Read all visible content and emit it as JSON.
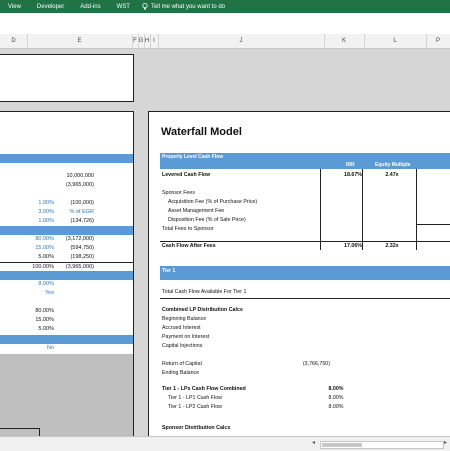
{
  "ribbon": {
    "tabs": [
      "View",
      "Developer",
      "Add-ins",
      "WST"
    ],
    "tell_me": "Tell me what you want to do"
  },
  "column_headers": [
    "D",
    "E",
    "F",
    "G",
    "H",
    "I",
    "J",
    "K",
    "L",
    "P"
  ],
  "left_panel": {
    "block1": [
      {
        "d": "",
        "e": "10,000,000"
      },
      {
        "d": "",
        "e": "(3,965,000)"
      },
      {
        "d": "1.00%",
        "e": "(100,000)"
      },
      {
        "d": "3.00%",
        "e": "% of EGR"
      },
      {
        "d": "1.00%",
        "e": "(134,726)"
      }
    ],
    "block2": [
      {
        "d": "80.00%",
        "e": "(3,172,000)"
      },
      {
        "d": "15.00%",
        "e": "(594,750)"
      },
      {
        "d": "5.00%",
        "e": "(198,250)"
      },
      {
        "d": "100.00%",
        "e": "(3,965,000)"
      }
    ],
    "block3": [
      {
        "d": "8.00%",
        "e": ""
      },
      {
        "d": "Yes",
        "e": ""
      },
      {
        "d": "",
        "e": ""
      },
      {
        "d": "80.00%",
        "e": ""
      },
      {
        "d": "15.00%",
        "e": ""
      },
      {
        "d": "5.00%",
        "e": ""
      }
    ],
    "block4": [
      {
        "d": "No",
        "e": ""
      }
    ]
  },
  "waterfall": {
    "title": "Waterfall Model",
    "property_header": "Property Level Cash Flow",
    "col_irr": "IRR",
    "col_equity_multiple": "Equity Multiple",
    "col_p": "P",
    "levered_label": "Levered Cash Flow",
    "levered_irr": "18.67%",
    "levered_em": "2.47x",
    "sponsor_fees_label": "Sponsor Fees",
    "acq_fee": "Acquisition Fee (% of Purchase Price)",
    "am_fee": "Asset Management Fee",
    "disp_fee": "Disposition Fee (% of Sale Price)",
    "total_fees": "Total Fees to Sponsor",
    "after_fees_label": "Cash Flow After Fees",
    "after_fees_irr": "17.06%",
    "after_fees_em": "2.32x",
    "tier1_header": "Tier 1",
    "total_available": "Total Cash Flow Available For Tier 1",
    "combined_lp": "Combined LP Distribution Calcs",
    "beginning_balance": "Beginning Balance",
    "accrued_interest": "Accrued Interest",
    "payment_interest": "Payment on Interest",
    "capital_injections": "Capital Injections",
    "return_of_capital": "Return of Capital",
    "return_of_capital_val": "(3,766,750)",
    "ending_balance": "Ending Balance",
    "tier1_lps": "Tier 1 - LPs Cash Flow Combined",
    "tier1_lps_val": "8.00%",
    "tier1_lp1": "Tier 1 - LP1 Cash Flow",
    "tier1_lp1_val": "8.00%",
    "tier1_lp2": "Tier 1 - LP2 Cash Flow",
    "tier1_lp2_val": "8.00%",
    "sponsor_calcs": "Sponsor Distribution Calcs"
  },
  "colors": {
    "ribbon": "#217346",
    "header_blue": "#5b9bd5",
    "value_blue": "#2e75b6"
  }
}
